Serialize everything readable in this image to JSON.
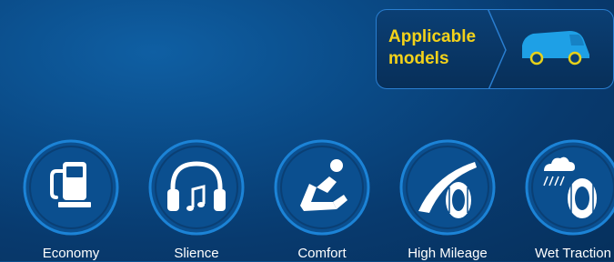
{
  "applicable_models": {
    "label_line1": "Applicable",
    "label_line2": "models",
    "icon": "van-icon",
    "accent_color": "#f3d21a"
  },
  "features": [
    {
      "label": "Economy",
      "icon": "fuel-pump-icon"
    },
    {
      "label": "Slience",
      "icon": "headphones-icon"
    },
    {
      "label": "Comfort",
      "icon": "reclining-seat-icon"
    },
    {
      "label": "High Mileage",
      "icon": "road-tire-icon"
    },
    {
      "label": "Wet Traction",
      "icon": "rain-tire-icon"
    }
  ]
}
